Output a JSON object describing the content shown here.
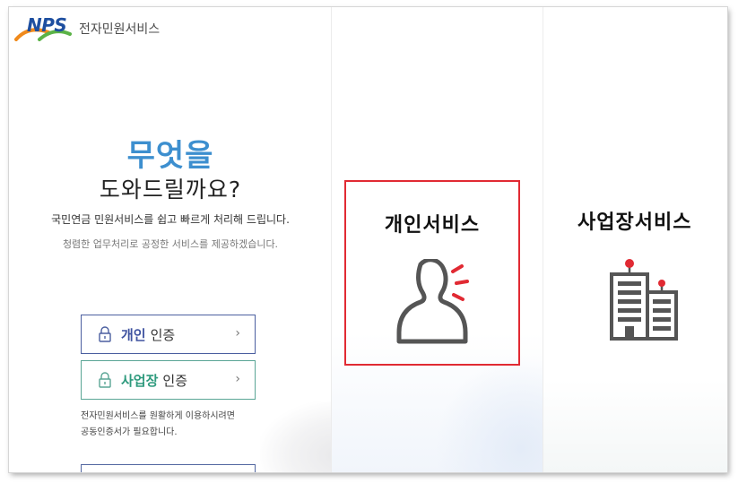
{
  "brand": {
    "logo_text": "NPS",
    "service_name": "전자민원서비스",
    "colors": {
      "blue": "#1e4fa0",
      "orange": "#f08a1c",
      "green": "#5bb347"
    }
  },
  "intro": {
    "title": "무엇을",
    "subtitle": "도와드릴까요?",
    "description": "국민연금 민원서비스를 쉽고 빠르게 처리해 드립니다.",
    "description_sub": "청렴한 업무처리로 공정한 서비스를 제공하겠습니다."
  },
  "auth": {
    "personal": {
      "strong": "개인",
      "label": "인증",
      "chevron": "›",
      "icon": "lock-icon"
    },
    "business": {
      "strong": "사업장",
      "label": "인증",
      "chevron": "›",
      "icon": "lock-icon"
    },
    "notice_line1": "전자민원서비스를 원활하게 이용하시려면",
    "notice_line2": "공동인증서가 필요합니다."
  },
  "services": {
    "personal": {
      "title": "개인서비스",
      "icon": "person-alert-icon",
      "highlight_color": "#e12a33"
    },
    "business": {
      "title": "사업장서비스",
      "icon": "building-icon"
    }
  }
}
